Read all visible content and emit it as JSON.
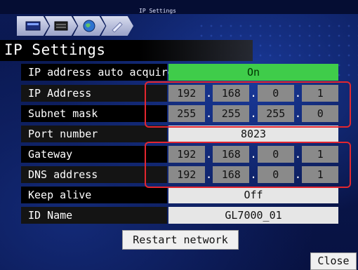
{
  "breadcrumb": {
    "label": "IP Settings",
    "icons": [
      "monitor-icon",
      "server-icon",
      "globe-icon",
      "pen-icon"
    ]
  },
  "page": {
    "title": "IP Settings"
  },
  "rows": {
    "auto_acquire": {
      "label": "IP address auto acquire",
      "value": "On"
    },
    "ip_address": {
      "label": "IP Address",
      "octets": [
        "192",
        "168",
        "0",
        "1"
      ]
    },
    "subnet": {
      "label": "Subnet mask",
      "octets": [
        "255",
        "255",
        "255",
        "0"
      ]
    },
    "port": {
      "label": "Port number",
      "value": "8023"
    },
    "gateway": {
      "label": "Gateway",
      "octets": [
        "192",
        "168",
        "0",
        "1"
      ]
    },
    "dns": {
      "label": "DNS address",
      "octets": [
        "192",
        "168",
        "0",
        "1"
      ]
    },
    "keep_alive": {
      "label": "Keep alive",
      "value": "Off"
    },
    "id_name": {
      "label": "ID Name",
      "value": "GL7000_01"
    }
  },
  "buttons": {
    "restart": "Restart network",
    "close": "Close"
  },
  "colors": {
    "highlight": "#e3262f",
    "on_green": "#3fcc4a",
    "background": "#0a1850"
  }
}
